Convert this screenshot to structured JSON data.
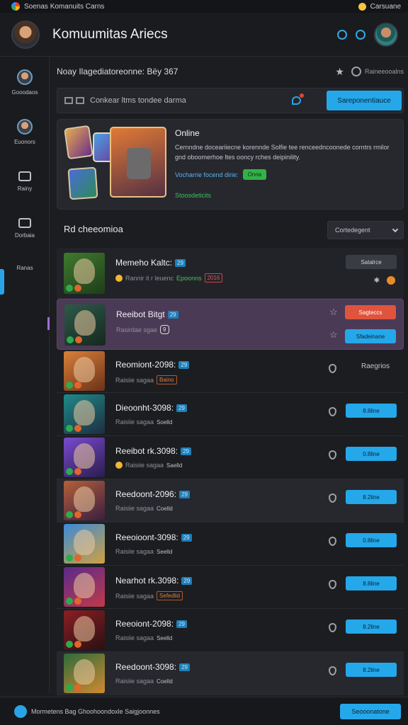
{
  "status": {
    "app_name": "Soenas Komanuits Carns",
    "right_label": "Carsuane"
  },
  "header": {
    "title": "Komuumitas Ariecs"
  },
  "sidebar": {
    "items": [
      {
        "label": "Gooodaos",
        "icon": "user-avatar-icon"
      },
      {
        "label": "Euonors",
        "icon": "user-avatar-icon"
      },
      {
        "label": "Rainy",
        "icon": "box-icon"
      },
      {
        "label": "Dorbaia",
        "icon": "box-icon"
      },
      {
        "label": "Ranas",
        "icon": ""
      }
    ]
  },
  "breadcrumb": {
    "text": "Noay Ilagediatoreonne: Bëy 367",
    "meta": "Raineeooalns"
  },
  "search": {
    "text": "Conkear ltms tondee darma",
    "button": "Sareponentiauce"
  },
  "online": {
    "title": "Online",
    "description": "Cernndne doceariiecne korennde Solfie tee renceedncoonede corntrs rmilor gnd oboomerhoe ltes ooncy rches deipinility.",
    "link": "Vocharrie focend dirie:",
    "badge": "Onna",
    "footer": "Stoosdeticits"
  },
  "section": {
    "title": "Rd cheeomioa",
    "dropdown": "Cortedegent"
  },
  "rows": [
    {
      "name": "Memeho Kaltc:",
      "level": "29",
      "sub": "Rannir it r leuenc",
      "tag": "Epoonns",
      "tag2": "2016",
      "action": "Satalrce"
    },
    {
      "name": "Reeibot Bitgt",
      "level": "29",
      "sub": "Rasirdae sgae",
      "tag": "9",
      "action": "Sagteccs",
      "action2": "Sfadeinane"
    },
    {
      "name": "Reomiont-2098:",
      "level": "29",
      "sub": "Raisiie sagaa",
      "tag": "Baino",
      "action": "Raegrios"
    },
    {
      "name": "Dieoonht-3098:",
      "level": "29",
      "sub": "Raisiie sagaa",
      "tag": "Soelld",
      "action": "8.8line"
    },
    {
      "name": "Reeibot rk.3098:",
      "level": "29",
      "sub": "Raisiie sagaa",
      "tag": "Saelld",
      "action": "0.8line"
    },
    {
      "name": "Reedoont-2096:",
      "level": "29",
      "sub": "Raisiie sagaa",
      "tag": "Coelld",
      "action": "8.2line"
    },
    {
      "name": "Reeoioont-3098:",
      "level": "29",
      "sub": "Raisiie sagaa",
      "tag": "Seelld",
      "action": "0.8line"
    },
    {
      "name": "Nearhot rk.3098:",
      "level": "29",
      "sub": "Raisiie sagaa",
      "tag": "Sefedlid",
      "action": "8.8line"
    },
    {
      "name": "Reeoiont-2098:",
      "level": "29",
      "sub": "Raisiie sagaa",
      "tag": "Seelld",
      "action": "8.2line"
    },
    {
      "name": "Reedoont-3098:",
      "level": "29",
      "sub": "Raisiie sagaa",
      "tag": "Coelld",
      "action": "8.2line"
    }
  ],
  "footer": {
    "text": "Mormetens Bag Ghoohoondoxle Saigjoonnes",
    "button": "Seooonatone"
  }
}
